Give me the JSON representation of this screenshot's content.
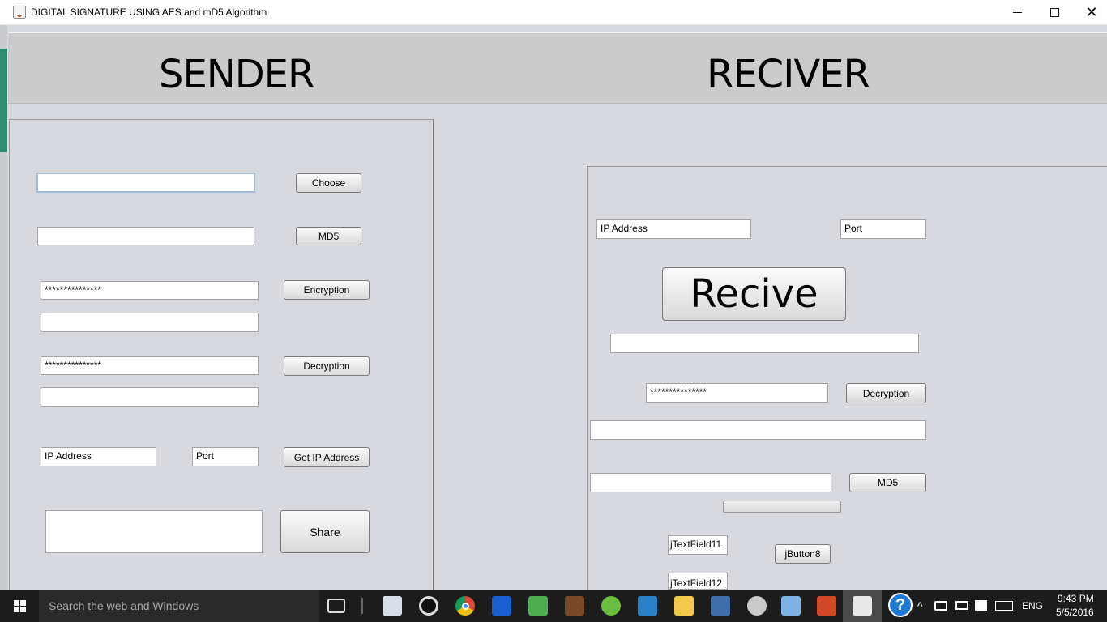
{
  "window": {
    "title": "DIGITAL SIGNATURE  USING AES and mD5 Algorithm",
    "close_glyph": "✕"
  },
  "header": {
    "sender_title": "SENDER",
    "receiver_title": "RECIVER"
  },
  "sender": {
    "file_path_value": "",
    "choose_label": "Choose",
    "md5_value": "",
    "md5_label": "MD5",
    "encryption_key": "***************",
    "encryption_label": "Encryption",
    "encrypted_output": "",
    "decryption_key": "***************",
    "decryption_label": "Decryption",
    "decrypted_output": "",
    "ip_address": "IP Address",
    "port": "Port",
    "get_ip_label": "Get IP Address",
    "share_text_value": "",
    "share_label": "Share"
  },
  "receiver": {
    "ip_address": "IP Address",
    "port": "Port",
    "recive_label": "Recive",
    "received_value": "",
    "decryption_key": "***************",
    "decryption_label": "Decryption",
    "decrypted_output": "",
    "md5_value": "",
    "md5_label": "MD5",
    "progress_percent": 0,
    "text_field_11": "jTextField11",
    "button_8": "jButton8",
    "text_field_12": "jTextField12"
  },
  "taskbar": {
    "search_placeholder": "Search the web and Windows",
    "language": "ENG",
    "time": "9:43 PM",
    "date": "5/5/2016",
    "help_glyph": "?",
    "icons": [
      "task-view-icon",
      "network-monitor-icon",
      "webcam-icon",
      "chrome-icon",
      "search-app-icon",
      "android-icon",
      "media-app-icon",
      "utorrent-icon",
      "box-app-icon",
      "file-explorer-icon",
      "control-panel-icon",
      "paint-icon",
      "virtualbox-icon",
      "powerpoint-icon",
      "java-icon"
    ]
  }
}
